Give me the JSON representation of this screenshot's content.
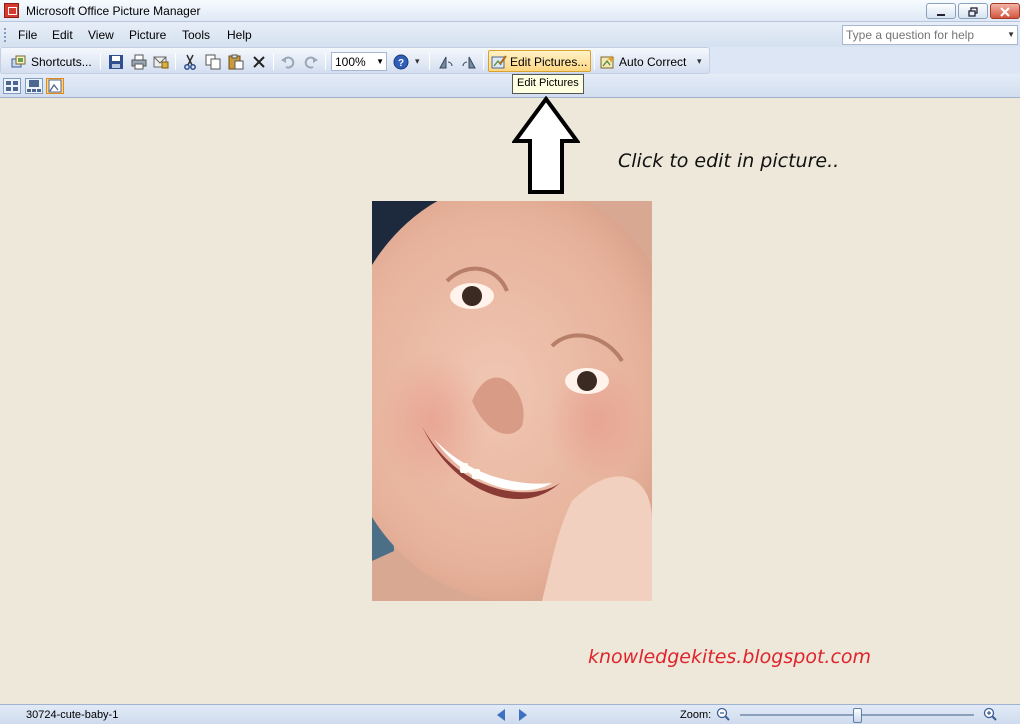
{
  "window": {
    "title": "Microsoft Office Picture Manager",
    "minimize_icon": "minimize-icon",
    "restore_icon": "restore-icon",
    "close_icon": "close-icon"
  },
  "menu": {
    "items": [
      "File",
      "Edit",
      "View",
      "Picture",
      "Tools",
      "Help"
    ],
    "help_placeholder": "Type a question for help"
  },
  "toolbar": {
    "shortcuts_label": "Shortcuts...",
    "zoom_value": "100%",
    "edit_pictures_label": "Edit Pictures...",
    "auto_correct_label": "Auto Correct",
    "icons": [
      "shortcuts-icon",
      "save-icon",
      "print-icon",
      "email-icon",
      "cut-icon",
      "copy-icon",
      "paste-icon",
      "delete-icon",
      "undo-icon",
      "redo-icon",
      "help-icon",
      "rotate-left-icon",
      "rotate-right-icon",
      "edit-pictures-icon",
      "auto-correct-icon"
    ]
  },
  "tooltip": {
    "text": "Edit Pictures"
  },
  "annotation": {
    "instruction": "Click to edit in picture..",
    "blog": "knowledgekites.blogspot.com"
  },
  "statusbar": {
    "filename": "30724-cute-baby-1",
    "zoom_label": "Zoom:",
    "zoom_level": 0.5
  },
  "colors": {
    "accent": "#ffd782",
    "blog_text": "#e0242c",
    "canvas_bg": "#ede8da"
  }
}
